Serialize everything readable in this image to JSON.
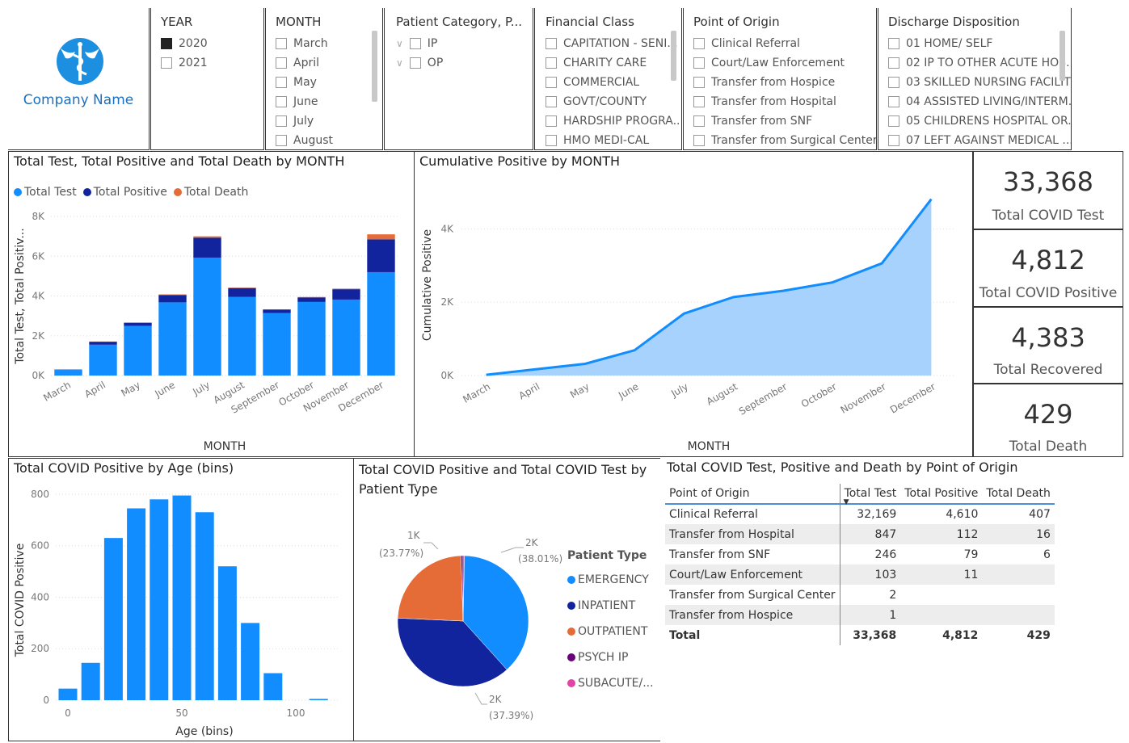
{
  "company": {
    "name": "Company Name"
  },
  "slicers": {
    "year": {
      "title": "YEAR",
      "items": [
        {
          "label": "2020",
          "checked": true
        },
        {
          "label": "2021",
          "checked": false
        }
      ]
    },
    "month": {
      "title": "MONTH",
      "items": [
        "March",
        "April",
        "May",
        "June",
        "July",
        "August"
      ]
    },
    "patient_category": {
      "title": "Patient Category, P...",
      "items": [
        "IP",
        "OP"
      ]
    },
    "financial_class": {
      "title": "Financial Class",
      "items": [
        "CAPITATION - SENI...",
        "CHARITY CARE",
        "COMMERCIAL",
        "GOVT/COUNTY",
        "HARDSHIP PROGRA...",
        "HMO MEDI-CAL"
      ]
    },
    "point_of_origin": {
      "title": "Point of Origin",
      "items": [
        "Clinical Referral",
        "Court/Law Enforcement",
        "Transfer from Hospice",
        "Transfer from Hospital",
        "Transfer from SNF",
        "Transfer from Surgical Center"
      ]
    },
    "discharge": {
      "title": "Discharge Disposition",
      "items": [
        "01 HOME/ SELF",
        "02 IP TO OTHER ACUTE HOS...",
        "03 SKILLED NURSING FACILITY",
        "04 ASSISTED LIVING/INTERM...",
        "05 CHILDRENS HOSPITAL OR...",
        "07 LEFT AGAINST MEDICAL ..."
      ]
    }
  },
  "cards": [
    {
      "value": "33,368",
      "label": "Total COVID Test"
    },
    {
      "value": "4,812",
      "label": "Total COVID Positive"
    },
    {
      "value": "4,383",
      "label": "Total Recovered"
    },
    {
      "value": "429",
      "label": "Total Death"
    }
  ],
  "colors": {
    "test": "#118DFF",
    "positive": "#12239E",
    "death": "#E66C37",
    "psych": "#6B007B",
    "subacute": "#E044A7",
    "area_fill": "#a6d2fd"
  },
  "chart_data": [
    {
      "type": "bar",
      "title": "Total Test, Total Positive and Total Death by MONTH",
      "xlabel": "MONTH",
      "ylabel": "Total Test, Total Positiv...",
      "stacked": true,
      "legend": "top-left",
      "categories": [
        "March",
        "April",
        "May",
        "June",
        "July",
        "August",
        "September",
        "October",
        "November",
        "December"
      ],
      "series": [
        {
          "name": "Total Test",
          "values": [
            280,
            1550,
            2500,
            3680,
            5930,
            3950,
            3140,
            3700,
            3820,
            5200
          ]
        },
        {
          "name": "Total Positive",
          "values": [
            20,
            150,
            150,
            370,
            1000,
            450,
            170,
            230,
            520,
            1650
          ]
        },
        {
          "name": "Total Death",
          "values": [
            0,
            10,
            20,
            30,
            70,
            20,
            20,
            20,
            30,
            250
          ]
        }
      ],
      "yticks": [
        "0K",
        "2K",
        "4K",
        "6K",
        "8K"
      ],
      "ylim": [
        0,
        8000
      ],
      "grid": true
    },
    {
      "type": "area",
      "title": "Cumulative Positive by MONTH",
      "xlabel": "MONTH",
      "ylabel": "Cumulative Positive",
      "categories": [
        "March",
        "April",
        "May",
        "June",
        "July",
        "August",
        "September",
        "October",
        "November",
        "December"
      ],
      "values": [
        20,
        170,
        320,
        690,
        1690,
        2140,
        2310,
        2540,
        3060,
        4812
      ],
      "yticks": [
        "0K",
        "2K",
        "4K"
      ],
      "ylim": [
        0,
        5000
      ],
      "grid": true
    },
    {
      "type": "bar",
      "title": "Total COVID Positive by Age (bins)",
      "xlabel": "Age (bins)",
      "ylabel": "Total COVID Positive",
      "categories": [
        0,
        10,
        20,
        30,
        40,
        50,
        60,
        70,
        80,
        90,
        100,
        110
      ],
      "values": [
        45,
        145,
        630,
        745,
        780,
        795,
        730,
        520,
        300,
        105,
        0,
        5
      ],
      "xticks": [
        "0",
        "50",
        "100"
      ],
      "yticks": [
        "0",
        "200",
        "400",
        "600",
        "800"
      ],
      "ylim": [
        0,
        850
      ],
      "grid": true
    },
    {
      "type": "pie",
      "title": "Total COVID Positive and Total COVID Test by Patient Type",
      "legend_title": "Patient Type",
      "slices": [
        {
          "name": "EMERGENCY",
          "percent": 38.01,
          "label": "2K",
          "pct_label": "(38.01%)"
        },
        {
          "name": "INPATIENT",
          "percent": 37.39,
          "label": "2K",
          "pct_label": "(37.39%)"
        },
        {
          "name": "OUTPATIENT",
          "percent": 23.77,
          "label": "1K",
          "pct_label": "(23.77%)"
        },
        {
          "name": "PSYCH IP",
          "percent": 0.5
        },
        {
          "name": "SUBACUTE/...",
          "percent": 0.33
        }
      ]
    }
  ],
  "matrix": {
    "title": "Total COVID Test, Positive and Death by Point of Origin",
    "columns": [
      "Point of Origin",
      "Total Test",
      "Total Positive",
      "Total Death"
    ],
    "rows": [
      [
        "Clinical Referral",
        "32,169",
        "4,610",
        "407"
      ],
      [
        "Transfer from Hospital",
        "847",
        "112",
        "16"
      ],
      [
        "Transfer from SNF",
        "246",
        "79",
        "6"
      ],
      [
        "Court/Law Enforcement",
        "103",
        "11",
        ""
      ],
      [
        "Transfer from Surgical Center",
        "2",
        "",
        ""
      ],
      [
        "Transfer from Hospice",
        "1",
        "",
        ""
      ]
    ],
    "total": [
      "Total",
      "33,368",
      "4,812",
      "429"
    ]
  }
}
